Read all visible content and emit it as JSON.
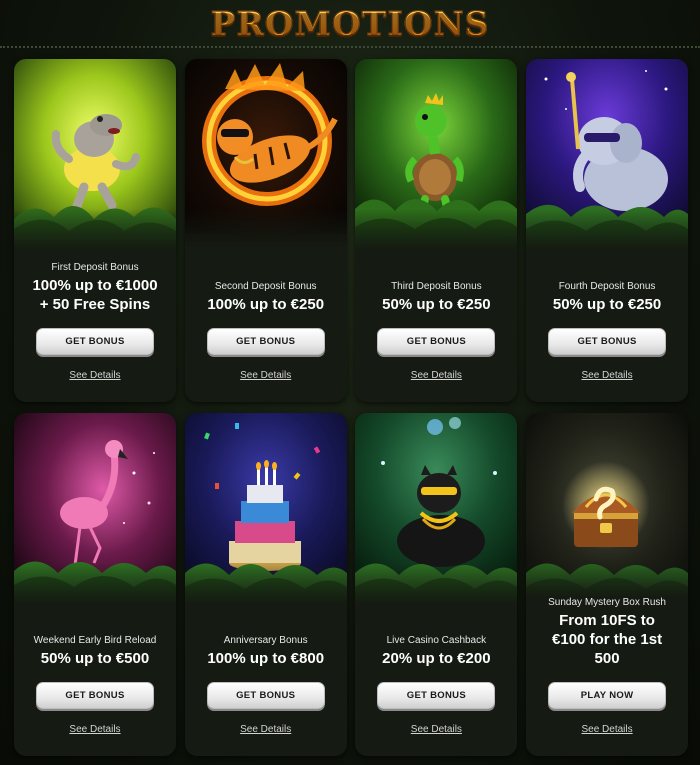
{
  "header": {
    "title": "PROMOTIONS"
  },
  "cards": [
    {
      "art": "hippo",
      "label": "First Deposit Bonus",
      "offer": "100% up to €1000\n+ 50 Free Spins",
      "button": "GET BONUS",
      "details": "See Details"
    },
    {
      "art": "tiger",
      "label": "Second Deposit Bonus",
      "offer": "100% up to €250",
      "button": "GET BONUS",
      "details": "See Details"
    },
    {
      "art": "turtle",
      "label": "Third Deposit Bonus",
      "offer": "50% up to €250",
      "button": "GET BONUS",
      "details": "See Details"
    },
    {
      "art": "elephant",
      "label": "Fourth Deposit Bonus",
      "offer": "50% up to €250",
      "button": "GET BONUS",
      "details": "See Details"
    },
    {
      "art": "flamingo",
      "label": "Weekend Early Bird Reload",
      "offer": "50% up to €500",
      "button": "GET BONUS",
      "details": "See Details"
    },
    {
      "art": "cake",
      "label": "Anniversary Bonus",
      "offer": "100% up to €800",
      "button": "GET BONUS",
      "details": "See Details"
    },
    {
      "art": "panther",
      "label": "Live Casino Cashback",
      "offer": "20% up to €200",
      "button": "GET BONUS",
      "details": "See Details"
    },
    {
      "art": "treasure-chest",
      "label": "Sunday Mystery Box Rush",
      "offer": "From 10FS to\n€100 for the 1st\n500",
      "button": "PLAY NOW",
      "details": "See Details"
    }
  ]
}
